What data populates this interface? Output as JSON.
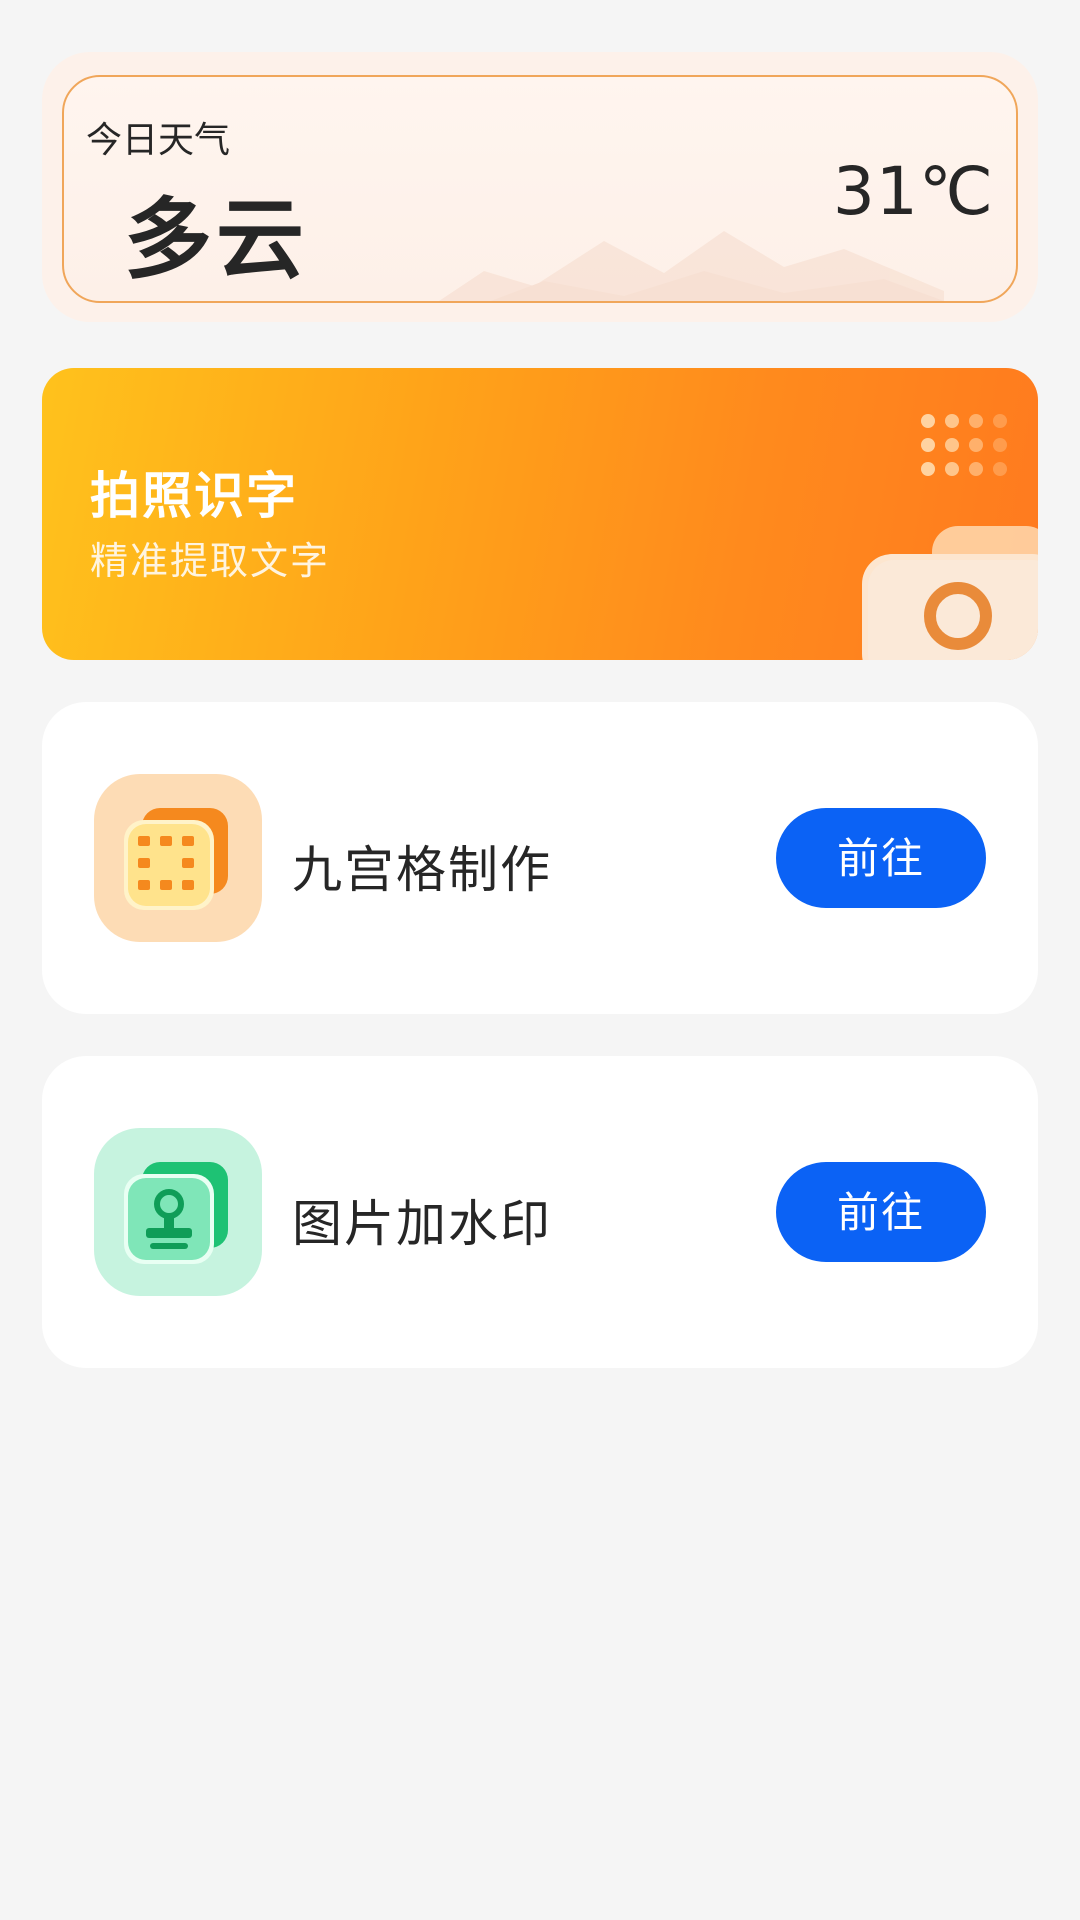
{
  "weather": {
    "label": "今日天气",
    "condition": "多云",
    "temperature": "31℃"
  },
  "ocr_banner": {
    "title": "拍照识字",
    "subtitle": "精准提取文字",
    "icon": "camera-icon"
  },
  "features": [
    {
      "title": "九宫格制作",
      "button_label": "前往",
      "icon": "grid-icon",
      "icon_bg": "#fddcb5",
      "icon_accent": "#f5891e"
    },
    {
      "title": "图片加水印",
      "button_label": "前往",
      "icon": "stamp-icon",
      "icon_bg": "#c6f3df",
      "icon_accent": "#1ec274"
    }
  ],
  "colors": {
    "page_bg": "#f5f5f5",
    "button_blue": "#0b62f5",
    "banner_orange": "#ff8a1d",
    "weather_border": "#f0a65a"
  }
}
